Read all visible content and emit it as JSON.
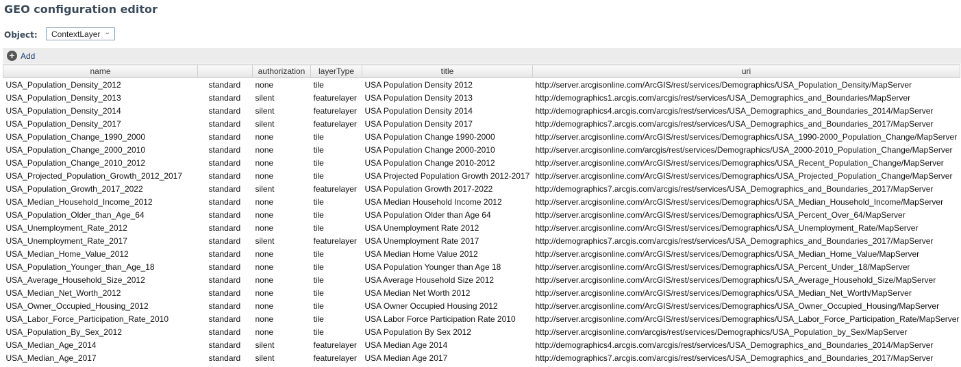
{
  "header": {
    "title": "GEO configuration editor"
  },
  "object": {
    "label": "Object:",
    "value": "ContextLayer"
  },
  "toolbar": {
    "add_label": "Add"
  },
  "table": {
    "columns": [
      "name",
      "",
      "authorization",
      "layerType",
      "title",
      "uri"
    ],
    "rows": [
      [
        "USA_Population_Density_2012",
        "standard",
        "none",
        "tile",
        "USA Population Density 2012",
        "http://server.arcgisonline.com/ArcGIS/rest/services/Demographics/USA_Population_Density/MapServer"
      ],
      [
        "USA_Population_Density_2013",
        "standard",
        "silent",
        "featurelayer",
        "USA Population Density 2013",
        "http://demographics1.arcgis.com/arcgis/rest/services/USA_Demographics_and_Boundaries/MapServer"
      ],
      [
        "USA_Population_Density_2014",
        "standard",
        "silent",
        "featurelayer",
        "USA Population Density 2014",
        "http://demographics4.arcgis.com/arcgis/rest/services/USA_Demographics_and_Boundaries_2014/MapServer"
      ],
      [
        "USA_Population_Density_2017",
        "standard",
        "silent",
        "featurelayer",
        "USA Population Density 2017",
        "http://demographics7.arcgis.com/arcgis/rest/services/USA_Demographics_and_Boundaries_2017/MapServer"
      ],
      [
        "USA_Population_Change_1990_2000",
        "standard",
        "none",
        "tile",
        "USA Population Change 1990-2000",
        "http://server.arcgisonline.com/ArcGIS/rest/services/Demographics/USA_1990-2000_Population_Change/MapServer"
      ],
      [
        "USA_Population_Change_2000_2010",
        "standard",
        "none",
        "tile",
        "USA Population Change 2000-2010",
        "http://server.arcgisonline.com/arcgis/rest/services/Demographics/USA_2000-2010_Population_Change/MapServer"
      ],
      [
        "USA_Population_Change_2010_2012",
        "standard",
        "none",
        "tile",
        "USA Population Change 2010-2012",
        "http://server.arcgisonline.com/ArcGIS/rest/services/Demographics/USA_Recent_Population_Change/MapServer"
      ],
      [
        "USA_Projected_Population_Growth_2012_2017",
        "standard",
        "none",
        "tile",
        "USA Projected Population Growth 2012-2017",
        "http://server.arcgisonline.com/ArcGIS/rest/services/Demographics/USA_Projected_Population_Change/MapServer"
      ],
      [
        "USA_Population_Growth_2017_2022",
        "standard",
        "silent",
        "featurelayer",
        "USA Population Growth 2017-2022",
        "http://demographics7.arcgis.com/arcgis/rest/services/USA_Demographics_and_Boundaries_2017/MapServer"
      ],
      [
        "USA_Median_Household_Income_2012",
        "standard",
        "none",
        "tile",
        "USA Median Household Income 2012",
        "http://server.arcgisonline.com/ArcGIS/rest/services/Demographics/USA_Median_Household_Income/MapServer"
      ],
      [
        "USA_Population_Older_than_Age_64",
        "standard",
        "none",
        "tile",
        "USA Population Older than Age 64",
        "http://server.arcgisonline.com/ArcGIS/rest/services/Demographics/USA_Percent_Over_64/MapServer"
      ],
      [
        "USA_Unemployment_Rate_2012",
        "standard",
        "none",
        "tile",
        "USA Unemployment Rate 2012",
        "http://server.arcgisonline.com/ArcGIS/rest/services/Demographics/USA_Unemployment_Rate/MapServer"
      ],
      [
        "USA_Unemployment_Rate_2017",
        "standard",
        "silent",
        "featurelayer",
        "USA Unemployment Rate 2017",
        "http://demographics7.arcgis.com/arcgis/rest/services/USA_Demographics_and_Boundaries_2017/MapServer"
      ],
      [
        "USA_Median_Home_Value_2012",
        "standard",
        "none",
        "tile",
        "USA Median Home Value 2012",
        "http://server.arcgisonline.com/ArcGIS/rest/services/Demographics/USA_Median_Home_Value/MapServer"
      ],
      [
        "USA_Population_Younger_than_Age_18",
        "standard",
        "none",
        "tile",
        "USA Population Younger than Age 18",
        "http://server.arcgisonline.com/ArcGIS/rest/services/Demographics/USA_Percent_Under_18/MapServer"
      ],
      [
        "USA_Average_Household_Size_2012",
        "standard",
        "none",
        "tile",
        "USA Average Household Size 2012",
        "http://server.arcgisonline.com/ArcGIS/rest/services/Demographics/USA_Average_Household_Size/MapServer"
      ],
      [
        "USA_Median_Net_Worth_2012",
        "standard",
        "none",
        "tile",
        "USA Median Net Worth 2012",
        "http://server.arcgisonline.com/ArcGIS/rest/services/Demographics/USA_Median_Net_Worth/MapServer"
      ],
      [
        "USA_Owner_Occupied_Housing_2012",
        "standard",
        "none",
        "tile",
        "USA Owner Occupied Housing 2012",
        "http://server.arcgisonline.com/ArcGIS/rest/services/Demographics/USA_Owner_Occupied_Housing/MapServer"
      ],
      [
        "USA_Labor_Force_Participation_Rate_2010",
        "standard",
        "none",
        "tile",
        "USA Labor Force Participation Rate 2010",
        "http://server.arcgisonline.com/ArcGIS/rest/services/Demographics/USA_Labor_Force_Participation_Rate/MapServer"
      ],
      [
        "USA_Population_By_Sex_2012",
        "standard",
        "none",
        "tile",
        "USA Population By Sex 2012",
        "http://server.arcgisonline.com/arcgis/rest/services/Demographics/USA_Population_by_Sex/MapServer"
      ],
      [
        "USA_Median_Age_2014",
        "standard",
        "silent",
        "featurelayer",
        "USA Median Age 2014",
        "http://demographics4.arcgis.com/arcgis/rest/services/USA_Demographics_and_Boundaries_2014/MapServer"
      ],
      [
        "USA_Median_Age_2017",
        "standard",
        "silent",
        "featurelayer",
        "USA Median Age 2017",
        "http://demographics7.arcgis.com/arcgis/rest/services/USA_Demographics_and_Boundaries_2017/MapServer"
      ]
    ]
  }
}
